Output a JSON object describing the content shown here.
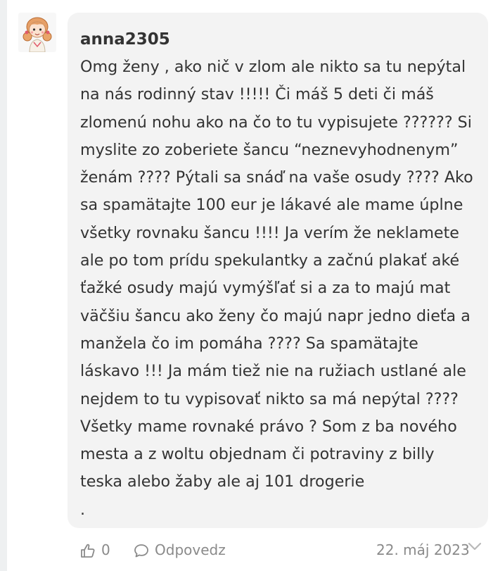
{
  "comment": {
    "username": "anna2305",
    "text_lines": [
      "Omg ženy , ako nič v zlom ale nikto sa tu nepýtal",
      "na nás rodinný stav !!!!! Či máš 5 deti či máš",
      "zlomenú nohu ako na čo to tu vypisujete ?????? Si",
      "myslite zo zoberiete šancu “neznevyhodnenym”",
      "ženám ???? Pýtali sa snáď na vaše osudy ???? Ako",
      "sa spamätajte 100 eur je lákavé ale mame úplne",
      "všetky rovnaku šancu !!!! Ja verím že neklamete",
      "ale po tom prídu spekulantky a začnú plakať aké",
      "ťažké osudy majú vymýšľať si a za to majú mat",
      "väčšiu šancu ako ženy čo majú napr jedno dieťa a",
      "manžela čo im pomáha ???? Sa spamätajte",
      "láskavo !!! Ja mám tiež nie na ružiach ustlané ale",
      "nejdem to tu vypisovať nikto sa má nepýtal ????",
      "Všetky mame rovnaké právo ? Som z ba nového",
      "mesta a z woltu objednam či potraviny z billy",
      "teska alebo žaby ale aj 101 drogerie",
      "."
    ]
  },
  "footer": {
    "like_count": "0",
    "reply_label": "Odpovedz",
    "date": "22. máj 2023"
  },
  "icons": {
    "like": "thumbs-up-icon",
    "reply": "speech-bubble-icon",
    "expand": "chevron-down-icon",
    "avatar": "girl-avatar"
  },
  "colors": {
    "bubble_bg": "#f3f3f3",
    "meta_text": "#8a8a8a",
    "body_text": "#333333",
    "side_bar": "#eef0f1"
  }
}
